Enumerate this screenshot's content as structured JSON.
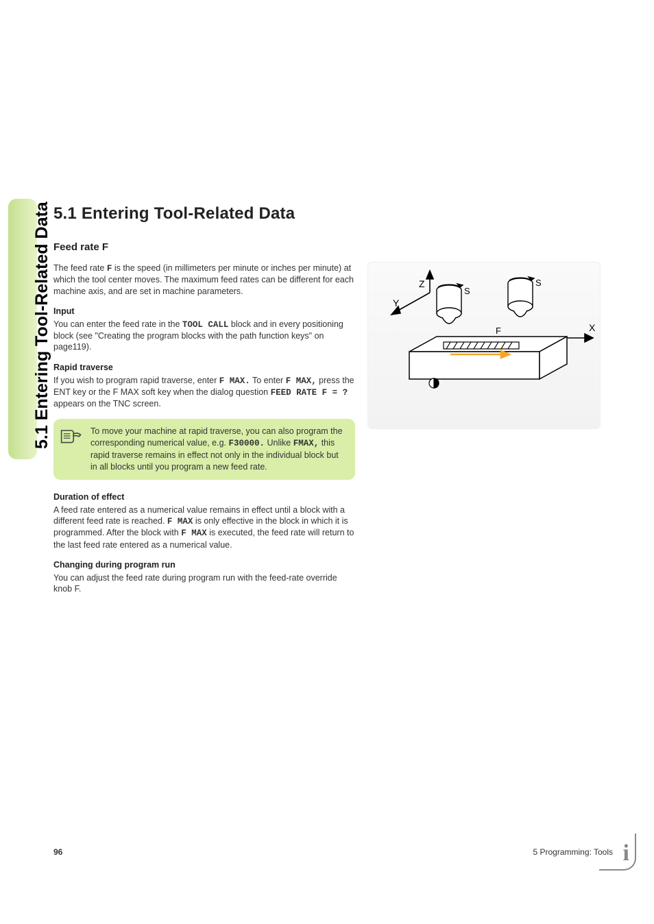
{
  "sidebar": {
    "tab_label": "5.1 Entering Tool-Related Data"
  },
  "main": {
    "title": "5.1  Entering Tool-Related Data",
    "h2": "Feed rate F",
    "intro_pre": "The feed rate ",
    "intro_bold": "F",
    "intro_post": " is the speed (in millimeters per minute or inches per minute) at which the tool center moves. The maximum feed rates can be different for each machine axis, and are set in machine parameters.",
    "h3_input": "Input",
    "input_pre": "You can enter the feed rate in the ",
    "input_mono": "TOOL CALL",
    "input_post": " block and in every positioning block (see \"Creating the program blocks with the path function keys\" on page119).",
    "h3_rapid": "Rapid traverse",
    "rapid_p1a": "If you wish to program rapid traverse, enter ",
    "rapid_fmax1": "F MAX.",
    "rapid_p1b": " To enter ",
    "rapid_fmax2": "F MAX,",
    "rapid_p1c": " press the ENT key or the F MAX soft key when the dialog question ",
    "rapid_feedq": "FEED RATE F = ?",
    "rapid_p1d": " appears on the TNC screen.",
    "note_p1": "To move your machine at rapid traverse, you can also program the corresponding numerical value, e.g. ",
    "note_bold1": "F30000.",
    "note_p2": " Unlike ",
    "note_bold2": "FMAX,",
    "note_p3": " this rapid traverse remains in effect not only in the individual block but in all blocks until you program a new feed rate.",
    "h3_duration": "Duration of effect",
    "dur_pre": "A feed rate entered as a numerical value remains in effect until a block with a different feed rate is reached. ",
    "dur_b1": "F MAX",
    "dur_mid": " is only effective in the block in which it is programmed. After the block with ",
    "dur_b2": "F MAX",
    "dur_post": " is executed, the feed rate will return to the last feed rate entered as a numerical value.",
    "h3_change": "Changing during program run",
    "change_text": "You can adjust the feed rate during program run with the feed-rate override knob F."
  },
  "diagram": {
    "labels": {
      "x": "X",
      "y": "Y",
      "z": "Z",
      "s1": "S",
      "s2": "S",
      "f": "F"
    }
  },
  "footer": {
    "page": "96",
    "section": "5 Programming: Tools"
  }
}
